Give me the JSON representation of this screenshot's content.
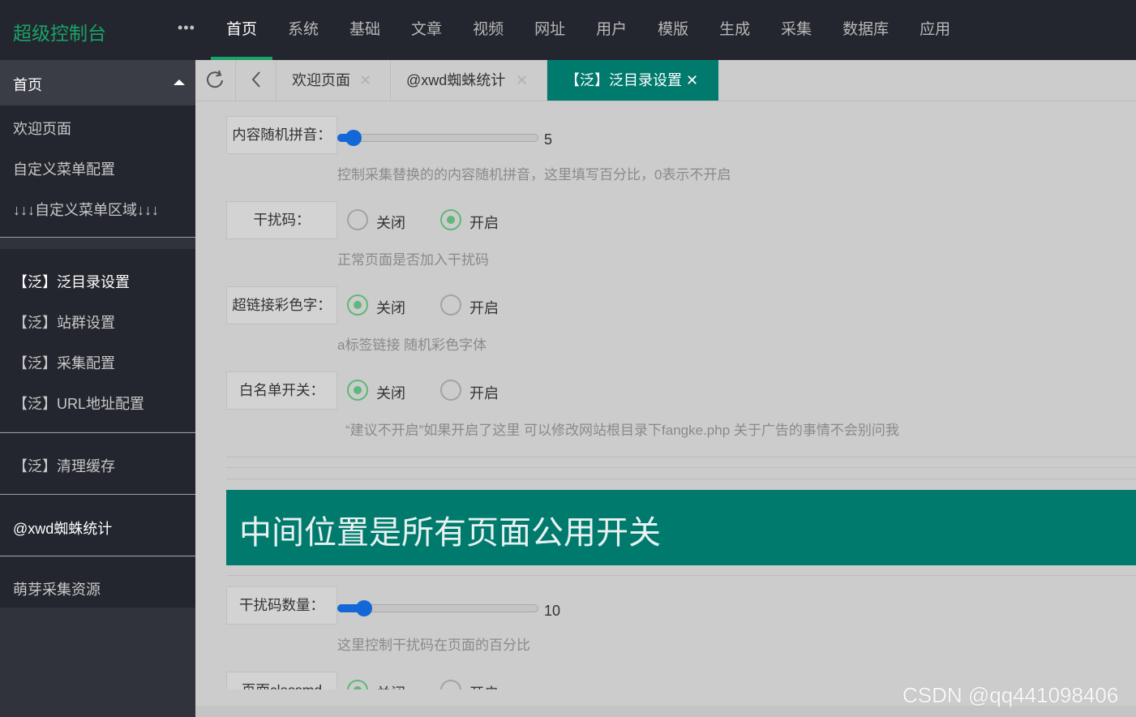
{
  "app": {
    "title": "超级控制台"
  },
  "nav": {
    "items": [
      "首页",
      "系统",
      "基础",
      "文章",
      "视频",
      "网址",
      "用户",
      "模版",
      "生成",
      "采集",
      "数据库",
      "应用"
    ],
    "active_index": 0
  },
  "sidebar": {
    "header": "首页",
    "group1": [
      "欢迎页面",
      "自定义菜单配置",
      "↓↓↓自定义菜单区域↓↓↓"
    ],
    "group2": [
      "【泛】泛目录设置",
      "【泛】站群设置",
      "【泛】采集配置",
      "【泛】URL地址配置"
    ],
    "group3": [
      "【泛】清理缓存"
    ],
    "group4": [
      "@xwd蜘蛛统计"
    ],
    "group5": [
      "萌芽采集资源"
    ]
  },
  "tabs": [
    {
      "label": "欢迎页面",
      "active": false
    },
    {
      "label": "@xwd蜘蛛统计",
      "active": false
    },
    {
      "label": "【泛】泛目录设置",
      "active": true
    }
  ],
  "form": {
    "pinyin": {
      "label": "内容随机拼音：",
      "value": 5,
      "max": 100,
      "hint": "控制采集替换的的内容随机拼音，这里填写百分比，0表示不开启"
    },
    "interference": {
      "label": "干扰码：",
      "options": [
        "关闭",
        "开启"
      ],
      "selected": "开启",
      "hint": "正常页面是否加入干扰码"
    },
    "colorlink": {
      "label": "超链接彩色字：",
      "options": [
        "关闭",
        "开启"
      ],
      "selected": "关闭",
      "hint": "a标签链接 随机彩色字体"
    },
    "whitelist": {
      "label": "白名单开关：",
      "options": [
        "关闭",
        "开启"
      ],
      "selected": "关闭",
      "hint": "“建议不开启”如果开启了这里 可以修改网站根目录下fangke.php 关于广告的事情不会别问我"
    },
    "section_title": "中间位置是所有页面公用开关",
    "interference_count": {
      "label": "干扰码数量：",
      "value": 10,
      "max": 100,
      "hint": "这里控制干扰码在页面的百分比"
    },
    "classmd": {
      "label": "页面classmd",
      "options": [
        "关闭",
        "开启"
      ],
      "selected": "关闭"
    }
  },
  "watermark": "CSDN @qq441098406",
  "colors": {
    "accent": "#1aa368",
    "teal": "#017a6e",
    "slider": "#1467d6",
    "radio_on": "#5fb878",
    "topbar": "#23262e"
  }
}
